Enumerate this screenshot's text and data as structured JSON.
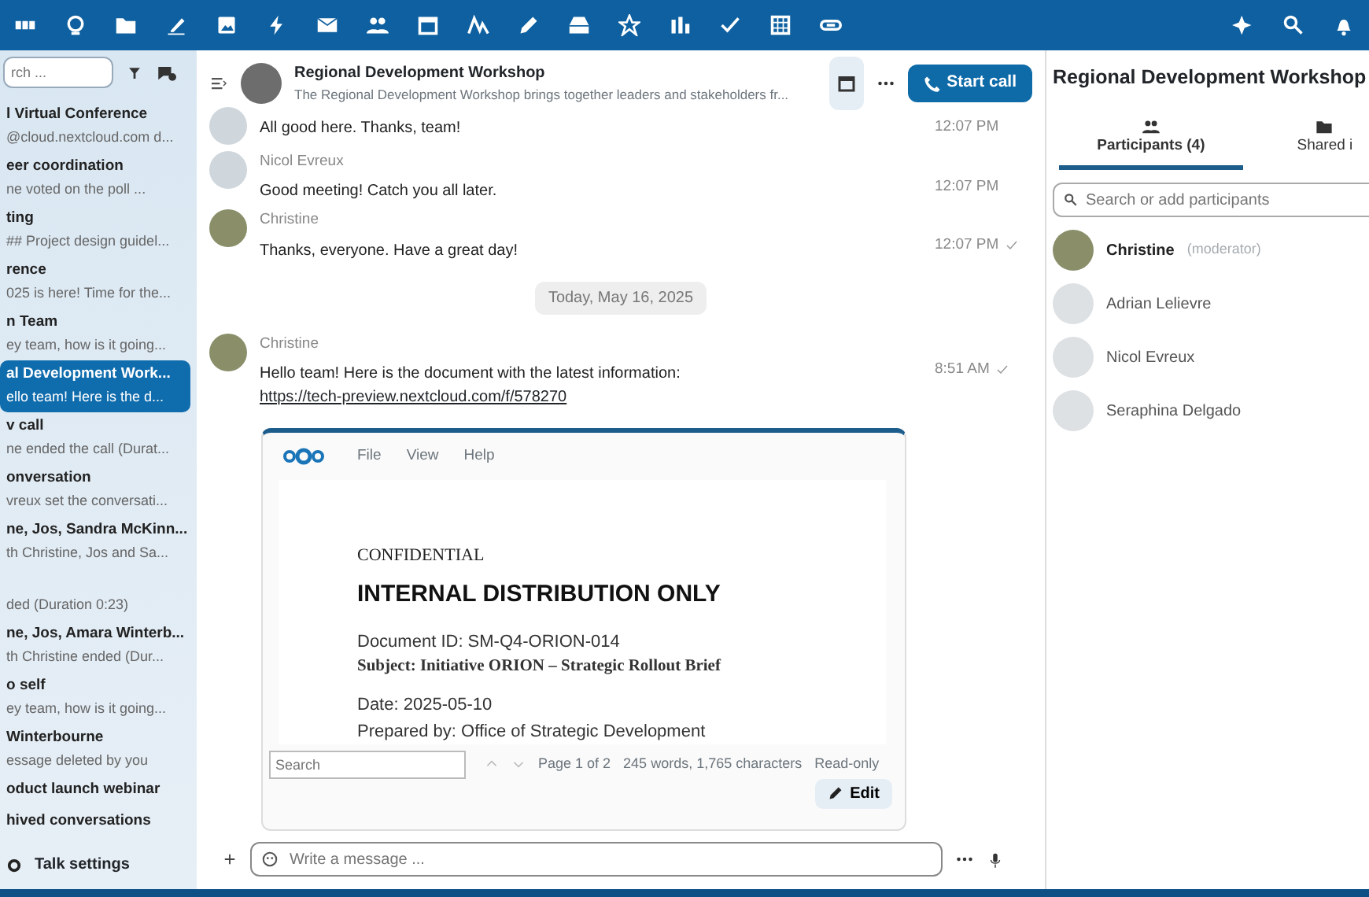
{
  "sidebar": {
    "search": {
      "placeholder": "rch ..."
    },
    "conversations": [
      {
        "title": "l Virtual Conference",
        "preview": "@cloud.nextcloud.com d...",
        "selected": false
      },
      {
        "title": "eer coordination",
        "preview": "ne voted on the poll ...",
        "selected": false
      },
      {
        "title": "ting",
        "preview": "## Project design guidel...",
        "selected": false
      },
      {
        "title": "rence",
        "preview": "025 is here! Time for the...",
        "selected": false
      },
      {
        "title": "n Team",
        "preview": "ey team, how is it going...",
        "selected": false
      },
      {
        "title": "al Development Work...",
        "preview": "ello team! Here is the d...",
        "selected": true
      },
      {
        "title": "v call",
        "preview": "ne ended the call (Durat...",
        "selected": false
      },
      {
        "title": "onversation",
        "preview": "vreux set the conversati...",
        "selected": false
      },
      {
        "title": "ne, Jos, Sandra McKinn...",
        "preview": "th Christine, Jos and Sa...",
        "selected": false
      },
      {
        "preview": "ded (Duration 0:23)",
        "selected": false
      },
      {
        "title": "ne, Jos, Amara Winterb...",
        "preview": "th Christine ended (Dur...",
        "selected": false
      },
      {
        "title": "o self",
        "preview": "ey team, how is it going...",
        "selected": false
      },
      {
        "title": "Winterbourne",
        "preview": "essage deleted by you",
        "selected": false
      },
      {
        "title": "oduct launch webinar",
        "selected": false
      }
    ],
    "archived": "hived conversations",
    "settings": "Talk settings"
  },
  "chat": {
    "title": "Regional Development Workshop",
    "description": "The Regional Development Workshop brings together leaders and stakeholders fr...",
    "start_call": "Start call",
    "messages": [
      {
        "kind": "message",
        "text": "All good here. Thanks, team!",
        "time": "12:07 PM",
        "sent": false
      },
      {
        "kind": "message",
        "author": "Nicol Evreux",
        "text": "Good meeting! Catch you all later.",
        "time": "12:07 PM",
        "sent": false
      },
      {
        "kind": "message",
        "author": "Christine",
        "text": "Thanks, everyone. Have a great day!",
        "time": "12:07 PM",
        "sent": true
      },
      {
        "kind": "date",
        "text": "Today, May 16, 2025"
      },
      {
        "kind": "message",
        "author": "Christine",
        "text": "Hello team! Here is the document with the latest information: ",
        "link": "https://tech-preview.nextcloud.com/f/578270",
        "time": "8:51 AM",
        "sent": true
      }
    ],
    "document": {
      "menu": [
        "File",
        "View",
        "Help"
      ],
      "lines": [
        {
          "kind": "label",
          "text": "CONFIDENTIAL"
        },
        {
          "kind": "heading",
          "text": "INTERNAL DISTRIBUTION ONLY"
        },
        {
          "kind": "text",
          "text": "Document ID: SM-Q4-ORION-014"
        },
        {
          "kind": "serif",
          "text": "Subject: Initiative ORION – Strategic Rollout Brief"
        },
        {
          "kind": "text",
          "text": "Date: 2025-05-10"
        },
        {
          "kind": "text",
          "text": "Prepared by: Office of Strategic Development"
        }
      ],
      "search": {
        "placeholder": "Search"
      },
      "page": "Page 1 of 2",
      "counts": "245 words, 1,765 characters",
      "mode": "Read-only",
      "edit": "Edit"
    },
    "composer": {
      "placeholder": "Write a message ..."
    }
  },
  "details": {
    "title": "Regional Development Workshop",
    "tabs": [
      {
        "label": "Participants (4)",
        "selected": true
      },
      {
        "label": "Shared i",
        "selected": false
      }
    ],
    "search": {
      "placeholder": "Search or add participants"
    },
    "participants": [
      {
        "name": "Christine",
        "role": "(moderator)",
        "active": true
      },
      {
        "name": "Adrian Lelievre",
        "active": false
      },
      {
        "name": "Nicol Evreux",
        "active": false
      },
      {
        "name": "Seraphina Delgado",
        "active": false
      }
    ]
  }
}
